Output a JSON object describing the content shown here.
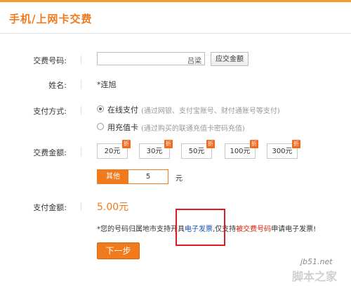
{
  "header": {
    "title": "手机/上网卡交费"
  },
  "form": {
    "phone": {
      "label": "交费号码:",
      "value": "",
      "suffix": "吕梁",
      "query_button": "应交金额"
    },
    "name": {
      "label": "姓名:",
      "value": "*连旭"
    },
    "payment": {
      "label": "支付方式:",
      "options": [
        {
          "label": "在线支付",
          "hint": "(通过网银、支付宝账号、财付通账号等支付)",
          "selected": true
        },
        {
          "label": "用充值卡",
          "hint": "(通过购买的联通充值卡密码充值)",
          "selected": false
        }
      ]
    },
    "amount": {
      "label": "交费金额:",
      "choices": [
        {
          "label": "20元",
          "badge": "折"
        },
        {
          "label": "30元",
          "badge": "折"
        },
        {
          "label": "50元",
          "badge": "折"
        },
        {
          "label": "100元",
          "badge": "折"
        },
        {
          "label": "300元",
          "badge": "折"
        }
      ],
      "other_label": "其他",
      "other_value": "5",
      "unit": "元"
    },
    "pay_amount": {
      "label": "支付金额:",
      "value": "5.00元"
    },
    "notice": {
      "part1": "*您的号码归属地市支持开具",
      "link1": "电子发票",
      "part2": ",仅支持",
      "link2": "被交费号码",
      "part3": "申请电子发票!"
    },
    "next_button": "下一步"
  },
  "watermark": {
    "site": "jb51.net",
    "name": "脚本之家"
  },
  "colors": {
    "accent": "#f07a1c",
    "link": "#1a4fb0",
    "red": "#d81e06",
    "highlight": "#e01b1b"
  }
}
